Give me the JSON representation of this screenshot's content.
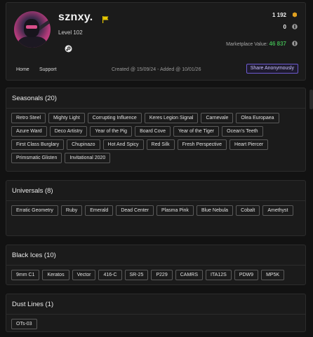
{
  "profile": {
    "username": "sznxy.",
    "level": "Level 102",
    "stat_1": "1 192",
    "stat_2": "0",
    "marketplace_label": "Marketplace Value:",
    "marketplace_value": "46 837",
    "created": "Created @ 15/09/24 - Added @ 10/01/26",
    "nav": {
      "home": "Home",
      "support": "Support"
    },
    "share_label": "Share Anonymously",
    "colors": {
      "marketplace_value": "#3fae4f",
      "flag": "#e6c700",
      "share_border": "#6d5ad0"
    }
  },
  "sections": {
    "seasonals": {
      "title": "Seasonals (20)",
      "items": [
        "Retro Steel",
        "Mighty Light",
        "Corrupting Influence",
        "Keres Legion Signal",
        "Carnevale",
        "Olea Europaea",
        "Azure Ward",
        "Deco Artistry",
        "Year of the Pig",
        "Board Cove",
        "Year of the Tiger",
        "Ocean's Teeth",
        "First Class Burglary",
        "Chupinazo",
        "Hot And Spicy",
        "Red Silk",
        "Fresh Perspective",
        "Heart Piercer",
        "Primsmatic Glisten",
        "Invitational 2020"
      ]
    },
    "universals": {
      "title": "Universals (8)",
      "items": [
        "Erratic Geometry",
        "Ruby",
        "Emerald",
        "Dead Center",
        "Plasma Pink",
        "Blue Nebula",
        "Cobalt",
        "Amethyst"
      ]
    },
    "blackices": {
      "title": "Black Ices (10)",
      "items": [
        "9mm C1",
        "Keratos",
        "Vector",
        "416-C",
        "SR-25",
        "P229",
        "CAMRS",
        "ITA12S",
        "PDW9",
        "MP5K"
      ]
    },
    "dustlines": {
      "title": "Dust Lines (1)",
      "items": [
        "OTs-03"
      ]
    }
  }
}
